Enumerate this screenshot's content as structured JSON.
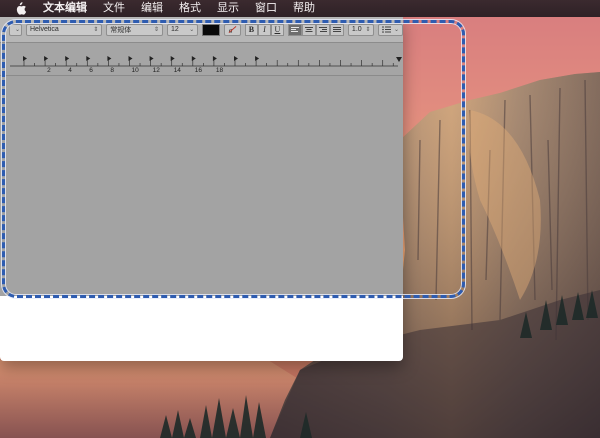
{
  "menubar": {
    "apple_icon": "apple-logo-icon",
    "items": [
      "文本编辑",
      "文件",
      "编辑",
      "格式",
      "显示",
      "窗口",
      "帮助"
    ]
  },
  "format_bar": {
    "paragraph_style_icon": "paragraph-style-icon",
    "font_family": "Helvetica",
    "font_style": "常规体",
    "font_size": "12",
    "text_color": "#000000",
    "highlight_color_icon": "a-slash-highlight-icon",
    "bold_label": "B",
    "italic_label": "I",
    "underline_label": "U",
    "alignment_icons": [
      "align-left-icon",
      "align-center-icon",
      "align-right-icon",
      "justify-icon"
    ],
    "active_alignment": "align-left-icon",
    "line_spacing": "1.0",
    "list_icon": "list-bullets-icon"
  },
  "ruler": {
    "numbers": [
      "2",
      "4",
      "6",
      "8",
      "10",
      "12",
      "14",
      "16",
      "18"
    ]
  },
  "colors": {
    "highlight_border": "#2e5cb0",
    "overlay": "#808080"
  }
}
